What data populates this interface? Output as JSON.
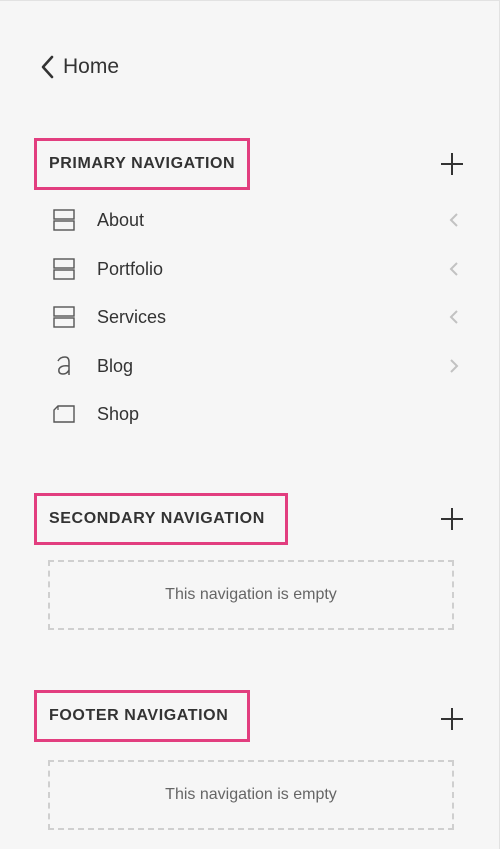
{
  "back": {
    "label": "Home"
  },
  "sections": {
    "primary": {
      "title": "PRIMARY NAVIGATION",
      "items": [
        {
          "label": "About",
          "icon": "folder-icon",
          "chevron": "chevron-left-icon"
        },
        {
          "label": "Portfolio",
          "icon": "folder-icon",
          "chevron": "chevron-left-icon"
        },
        {
          "label": "Services",
          "icon": "folder-icon",
          "chevron": "chevron-left-icon"
        },
        {
          "label": "Blog",
          "icon": "blog-icon",
          "chevron": "chevron-right-icon"
        },
        {
          "label": "Shop",
          "icon": "shop-icon"
        }
      ]
    },
    "secondary": {
      "title": "SECONDARY NAVIGATION",
      "empty_text": "This navigation is empty"
    },
    "footer": {
      "title": "FOOTER NAVIGATION",
      "empty_text": "This navigation is empty"
    }
  },
  "colors": {
    "highlight": "#e23e7f",
    "text": "#333333",
    "background": "#f6f6f6"
  }
}
